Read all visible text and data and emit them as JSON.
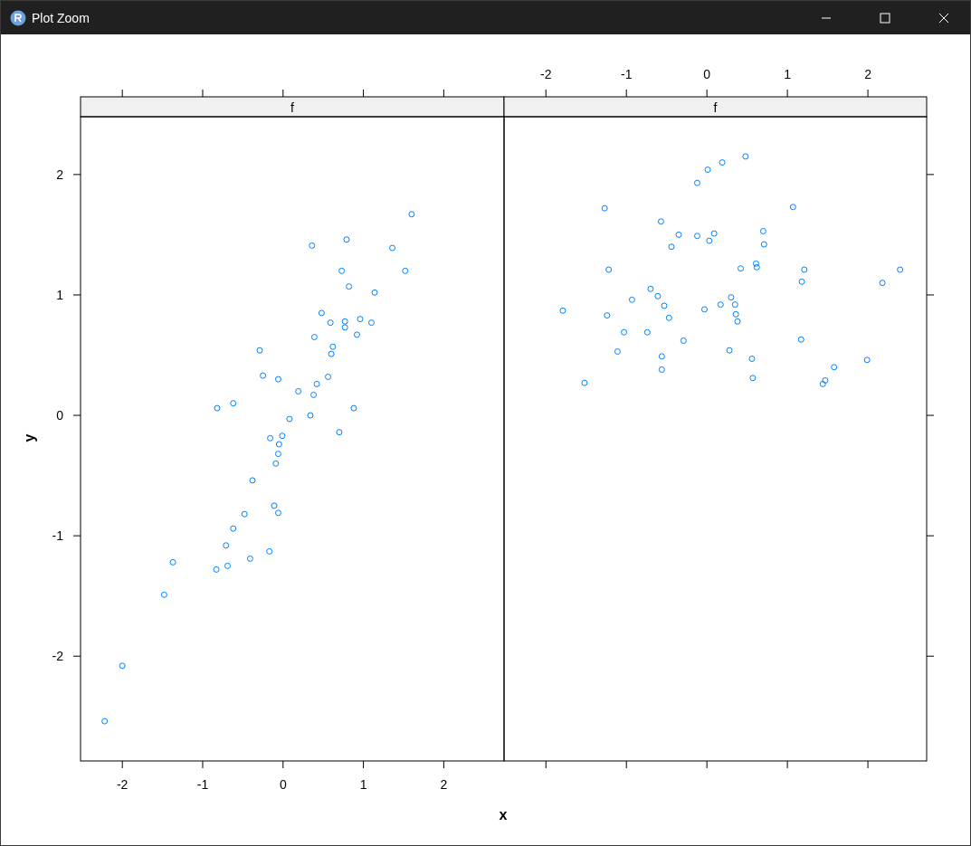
{
  "window": {
    "title": "Plot Zoom"
  },
  "plot": {
    "xlabel": "x",
    "ylabel": "y",
    "panels": [
      {
        "strip": "f",
        "chart_data": {
          "type": "scatter",
          "xlim": [
            -2.52,
            2.75
          ],
          "ylim": [
            -2.87,
            2.48
          ],
          "xticks": [
            -2,
            -1,
            0,
            1,
            2
          ],
          "yticks": [
            -2,
            -1,
            0,
            1,
            2
          ],
          "x": [
            -2.22,
            -2.0,
            -1.48,
            -1.37,
            -0.83,
            -0.71,
            -0.69,
            -0.62,
            -0.48,
            -0.41,
            -0.38,
            -0.17,
            -0.11,
            -0.06,
            -0.16,
            -0.09,
            -0.06,
            -0.05,
            -0.01,
            0.08,
            -0.82,
            -0.62,
            -0.29,
            -0.25,
            -0.06,
            0.19,
            0.34,
            0.38,
            0.42,
            0.39,
            0.36,
            0.48,
            0.56,
            0.59,
            0.6,
            0.62,
            0.7,
            0.73,
            0.77,
            0.77,
            0.79,
            0.82,
            0.88,
            0.92,
            0.96,
            1.1,
            1.14,
            1.36,
            1.52,
            1.6
          ],
          "series": [
            {
              "color": "#0080ff",
              "values": [
                -2.54,
                -2.08,
                -1.49,
                -1.22,
                -1.28,
                -1.08,
                -1.25,
                -0.94,
                -0.82,
                -1.19,
                -0.54,
                -1.13,
                -0.75,
                -0.81,
                -0.19,
                -0.4,
                -0.32,
                -0.24,
                -0.17,
                -0.03,
                0.06,
                0.1,
                0.54,
                0.33,
                0.3,
                0.2,
                0.0,
                0.17,
                0.26,
                0.65,
                1.41,
                0.85,
                0.32,
                0.77,
                0.51,
                0.57,
                -0.14,
                1.2,
                0.73,
                0.78,
                1.46,
                1.07,
                0.06,
                0.67,
                0.8,
                0.77,
                1.02,
                1.39,
                1.2,
                1.67
              ]
            }
          ]
        }
      },
      {
        "strip": "f",
        "chart_data": {
          "type": "scatter",
          "xlim": [
            -2.52,
            2.73
          ],
          "ylim": [
            -2.87,
            2.48
          ],
          "xticks": [
            -2,
            -1,
            0,
            1,
            2
          ],
          "x": [
            -1.79,
            -1.52,
            -1.27,
            -1.24,
            -1.22,
            -1.11,
            -1.03,
            -0.93,
            -0.74,
            -0.7,
            -0.61,
            -0.57,
            -0.56,
            -0.56,
            -0.53,
            -0.47,
            -0.44,
            -0.35,
            -0.29,
            -0.12,
            -0.12,
            -0.03,
            0.01,
            0.03,
            0.09,
            0.17,
            0.19,
            0.28,
            0.3,
            0.35,
            0.36,
            0.38,
            0.42,
            0.48,
            0.56,
            0.57,
            0.61,
            0.62,
            0.7,
            0.71,
            1.07,
            1.17,
            1.18,
            1.21,
            1.44,
            1.47,
            1.58,
            1.99,
            2.18,
            2.4
          ],
          "series": [
            {
              "color": "#0080ff",
              "values": [
                0.87,
                0.27,
                1.72,
                0.83,
                1.21,
                0.53,
                0.69,
                0.96,
                0.69,
                1.05,
                0.99,
                1.61,
                0.49,
                0.38,
                0.91,
                0.81,
                1.4,
                1.5,
                0.62,
                1.93,
                1.49,
                0.88,
                2.04,
                1.45,
                1.51,
                0.92,
                2.1,
                0.54,
                0.98,
                0.92,
                0.84,
                0.78,
                1.22,
                2.15,
                0.47,
                0.31,
                1.26,
                1.23,
                1.53,
                1.42,
                1.73,
                0.63,
                1.11,
                1.21,
                0.26,
                0.29,
                0.4,
                0.46,
                1.1,
                1.21
              ]
            }
          ]
        }
      }
    ]
  }
}
